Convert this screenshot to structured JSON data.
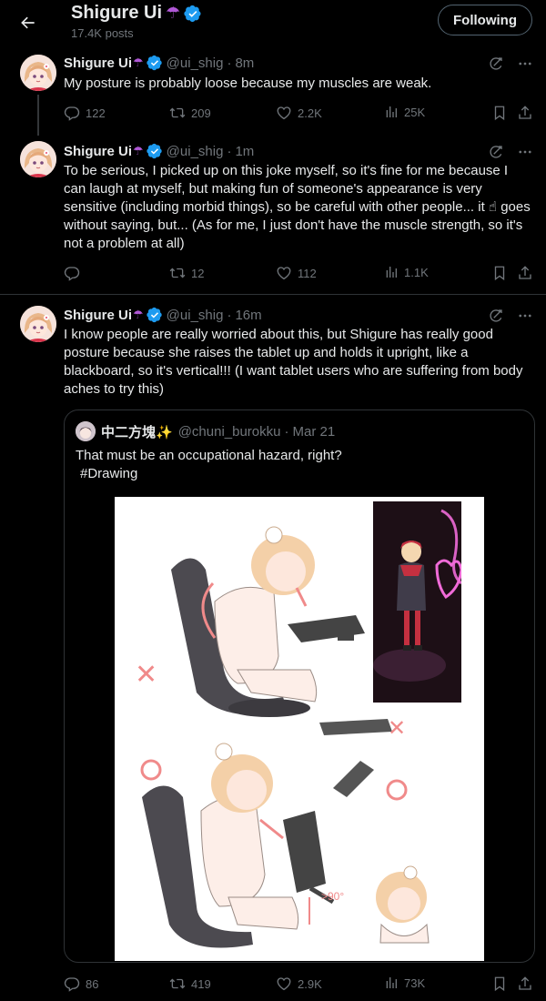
{
  "header": {
    "name": "Shigure Ui",
    "name_emoji": "☂",
    "posts_count": "17.4K posts",
    "follow_label": "Following"
  },
  "tweets": [
    {
      "name": "Shigure Ui",
      "emoji": "☂",
      "handle": "@ui_shig",
      "time": "8m",
      "text": "My posture is probably loose because my muscles are weak.",
      "replies": "122",
      "retweets": "209",
      "likes": "2.2K",
      "views": "25K"
    },
    {
      "name": "Shigure Ui",
      "emoji": "☂",
      "handle": "@ui_shig",
      "time": "1m",
      "text": "To be serious, I picked up on this joke myself, so it's fine for me because I can laugh at myself, but making fun of someone's appearance is very sensitive (including morbid things), so be careful with other people... it ☝ goes without saying, but... (As for me, I just don't have the muscle strength, so it's not a problem at all)",
      "replies": "",
      "retweets": "12",
      "likes": "112",
      "views": "1.1K"
    },
    {
      "name": "Shigure Ui",
      "emoji": "☂",
      "handle": "@ui_shig",
      "time": "16m",
      "text": "I know people are really worried about this, but Shigure has really good posture because she raises the tablet up and holds it upright, like a blackboard, so it's vertical!!! (I want tablet users who are suffering from body aches to try this)",
      "replies": "86",
      "retweets": "419",
      "likes": "2.9K",
      "views": "73K"
    }
  ],
  "quote": {
    "name": "中二方塊✨",
    "handle": "@chuni_burokku",
    "time": "Mar 21",
    "text_line1": "That must be an occupational hazard, right?",
    "hashtag": "#Drawing",
    "image_label": ">90°"
  },
  "colors": {
    "background": "#000000",
    "text": "#e7e9ea",
    "muted": "#71767b",
    "border": "#2f3336",
    "verified": "#1d9bf0",
    "accent_pink": "#f08a8a"
  },
  "icons": {
    "back": "arrow-left-icon",
    "verified": "verified-badge-icon",
    "grok": "grok-icon",
    "more": "more-icon",
    "reply": "reply-icon",
    "retweet": "retweet-icon",
    "like": "like-icon",
    "views": "views-icon",
    "bookmark": "bookmark-icon",
    "share": "share-icon"
  }
}
